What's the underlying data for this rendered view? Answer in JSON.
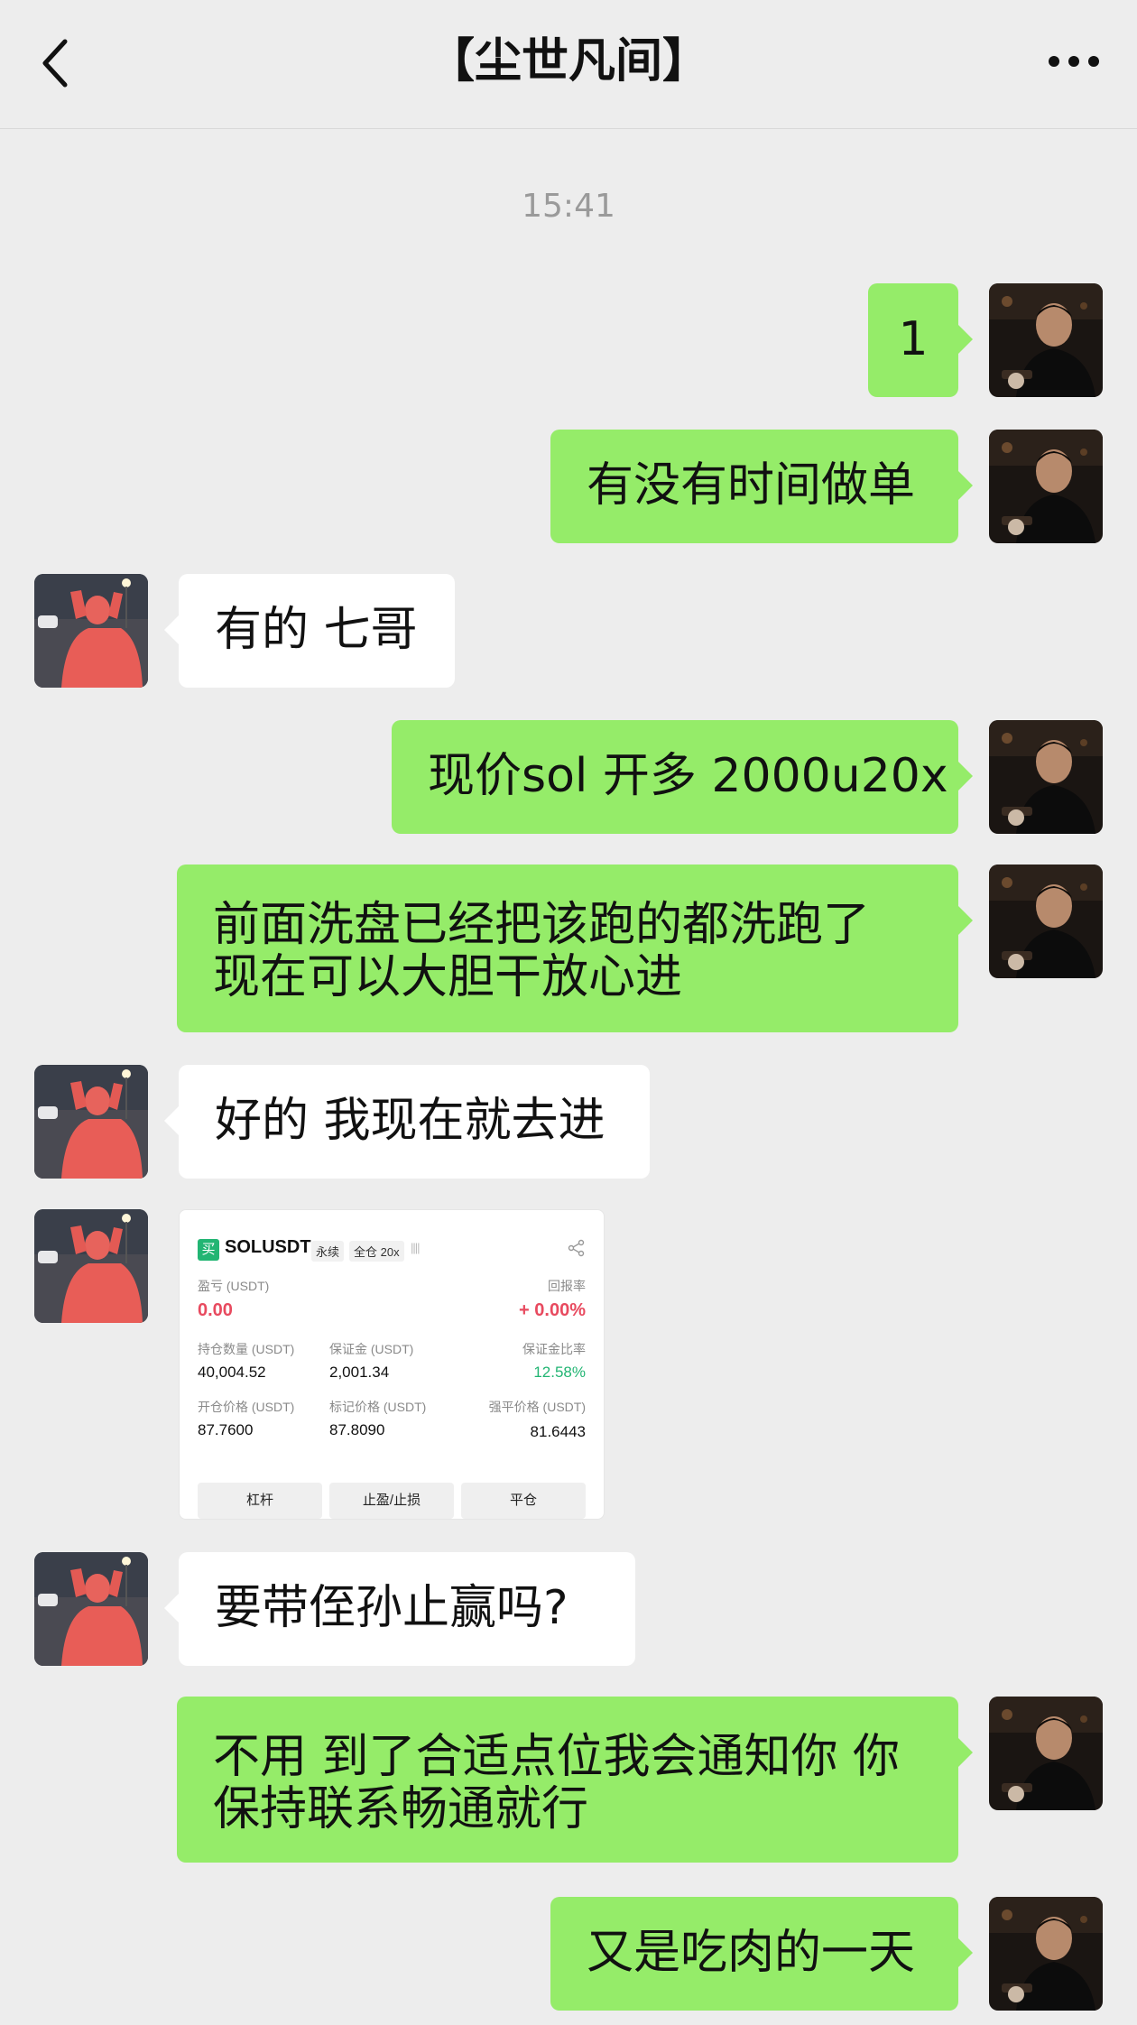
{
  "header": {
    "title": "【尘世凡间】"
  },
  "timestamp": "15:41",
  "messages": [
    {
      "from": "me",
      "text": "1"
    },
    {
      "from": "me",
      "text": "有没有时间做单"
    },
    {
      "from": "them",
      "text": "有的 七哥"
    },
    {
      "from": "me",
      "text": "现价sol 开多 2000u20x"
    },
    {
      "from": "me",
      "lines": [
        "前面洗盘已经把该跑的都洗跑了",
        "现在可以大胆干放心进"
      ]
    },
    {
      "from": "them",
      "text": "好的 我现在就去进"
    },
    {
      "from": "them",
      "type": "image"
    },
    {
      "from": "them",
      "text": "要带侄孙止赢吗?"
    },
    {
      "from": "me",
      "lines": [
        "不用 到了合适点位我会通知你 你",
        "保持联系畅通就行"
      ]
    },
    {
      "from": "me",
      "text": "又是吃肉的一天"
    }
  ],
  "position_card": {
    "buy_badge": "买",
    "symbol": "SOLUSDT",
    "tag_perpetual": "永续",
    "tag_margin": "全仓 20x",
    "signal": "||||",
    "pnl_label": "盈亏 (USDT)",
    "pnl_value": "0.00",
    "roe_label": "回报率",
    "roe_value": "+ 0.00%",
    "size_label": "持仓数量 (USDT)",
    "size_value": "40,004.52",
    "margin_label": "保证金 (USDT)",
    "margin_value": "2,001.34",
    "margin_ratio_label": "保证金比率",
    "margin_ratio_value": "12.58%",
    "entry_label": "开仓价格 (USDT)",
    "entry_value": "87.7600",
    "mark_label": "标记价格 (USDT)",
    "mark_value": "87.8090",
    "liq_label": "强平价格 (USDT)",
    "liq_value": "81.6443",
    "buttons": [
      "杠杆",
      "止盈/止损",
      "平仓"
    ]
  },
  "colors": {
    "background": "#ededed",
    "my_bubble": "#95ec69",
    "their_bubble": "#ffffff",
    "loss_red": "#e84a5f",
    "gain_green": "#22b573"
  },
  "icons": {
    "back": "chevron-left-icon",
    "more": "more-dots-icon",
    "share": "share-icon"
  }
}
